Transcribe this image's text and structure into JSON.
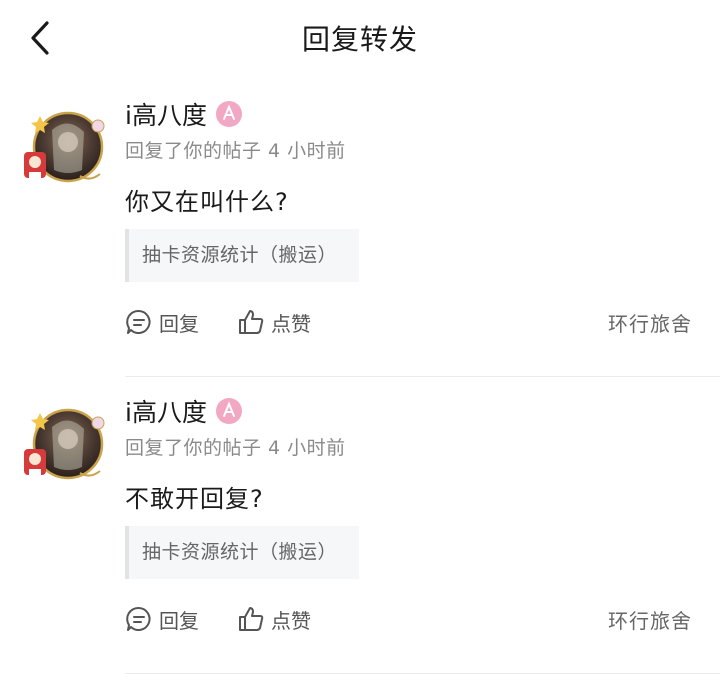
{
  "header": {
    "title": "回复转发",
    "back_icon": "chevron-left-icon"
  },
  "notifications": [
    {
      "user": "i高八度",
      "badge_icon": "pink-badge-icon",
      "meta": "回复了你的帖子 4 小时前",
      "content": "你又在叫什么?",
      "quote": "抽卡资源统计（搬运）",
      "reply_label": "回复",
      "like_label": "点赞",
      "board": "环行旅舍"
    },
    {
      "user": "i高八度",
      "badge_icon": "pink-badge-icon",
      "meta": "回复了你的帖子 4 小时前",
      "content": "不敢开回复?",
      "quote": "抽卡资源统计（搬运）",
      "reply_label": "回复",
      "like_label": "点赞",
      "board": "环行旅舍"
    }
  ],
  "colors": {
    "badge": "#f2a7c3",
    "text_secondary": "#8a8a8a",
    "quote_bg": "#f6f7f8"
  }
}
